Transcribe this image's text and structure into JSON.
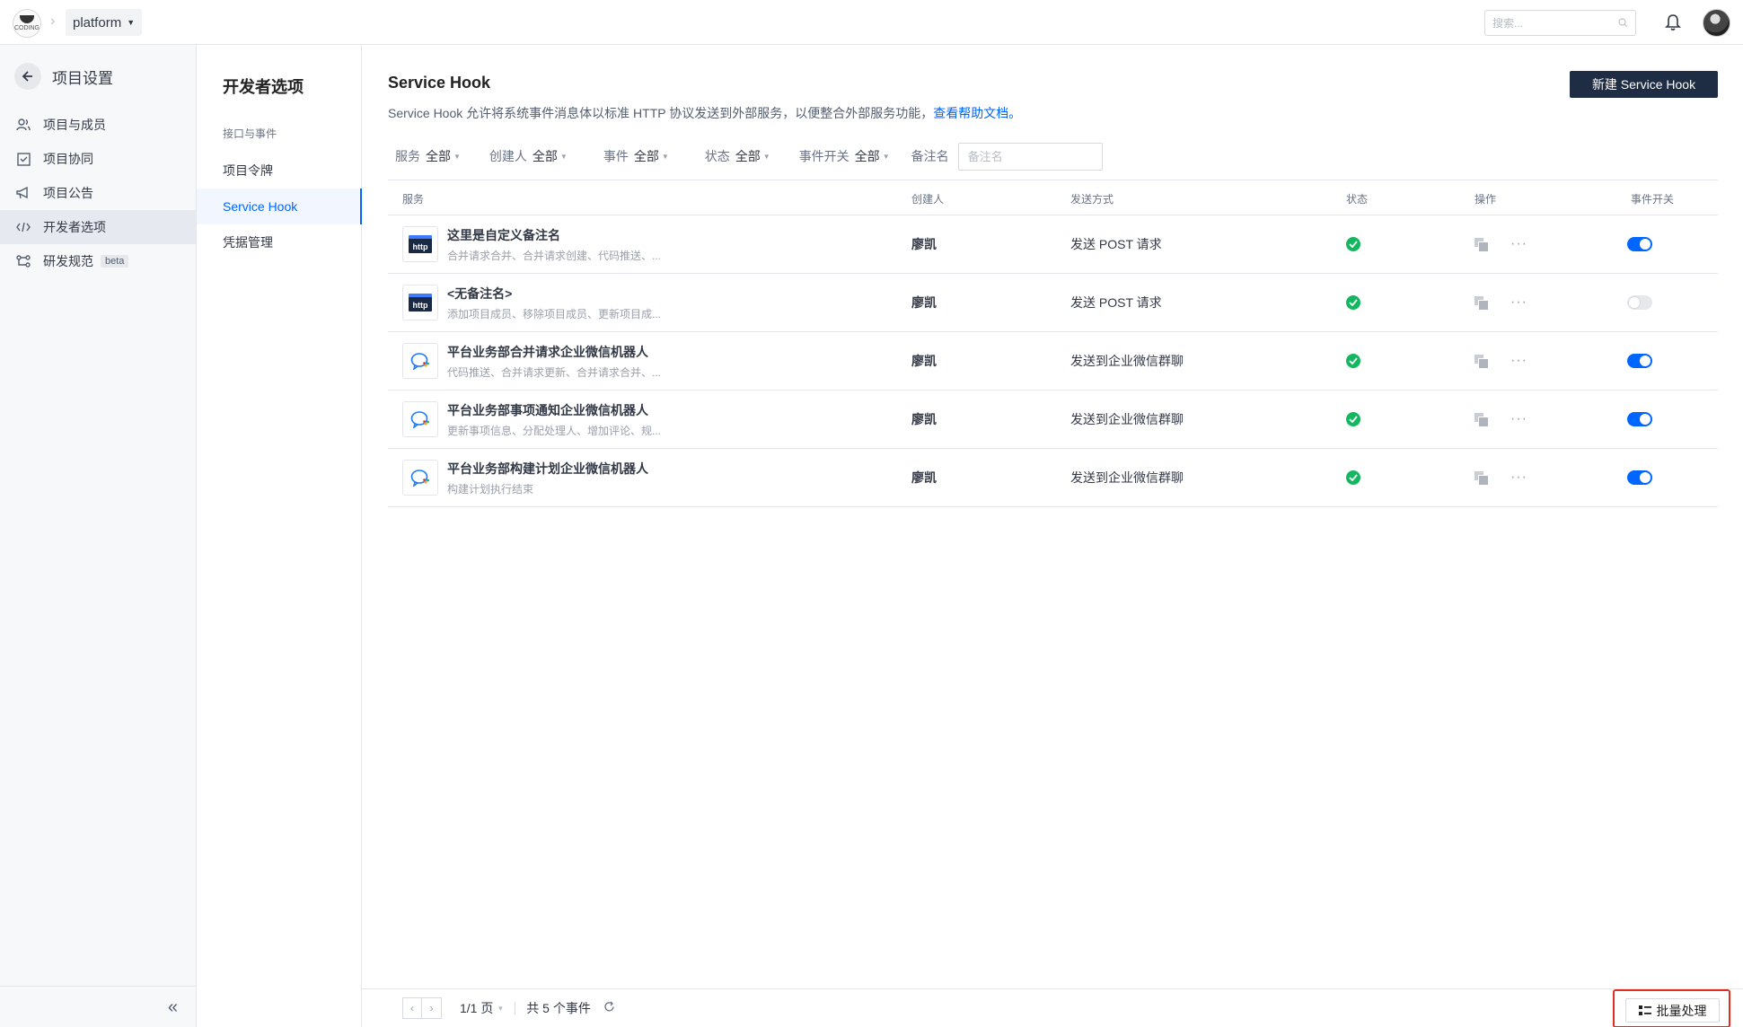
{
  "topbar": {
    "logo_text": "CODING",
    "project_name": "platform",
    "search_placeholder": "搜索..."
  },
  "sidebar": {
    "title": "项目设置",
    "items": [
      {
        "label": "项目与成员",
        "icon": "members-icon"
      },
      {
        "label": "项目协同",
        "icon": "collaboration-icon"
      },
      {
        "label": "项目公告",
        "icon": "announcement-icon"
      },
      {
        "label": "开发者选项",
        "icon": "code-icon",
        "active": true
      },
      {
        "label": "研发规范",
        "icon": "workflow-icon",
        "badge": "beta"
      }
    ]
  },
  "subnav": {
    "title": "开发者选项",
    "group": "接口与事件",
    "items": [
      {
        "label": "项目令牌"
      },
      {
        "label": "Service Hook",
        "active": true
      },
      {
        "label": "凭据管理"
      }
    ]
  },
  "main": {
    "title": "Service Hook",
    "description": "Service Hook 允许将系统事件消息体以标准 HTTP 协议发送到外部服务，以便整合外部服务功能，",
    "help_link": "查看帮助文档。",
    "new_button": "新建 Service Hook",
    "filters": [
      {
        "label": "服务",
        "value": "全部"
      },
      {
        "label": "创建人",
        "value": "全部"
      },
      {
        "label": "事件",
        "value": "全部"
      },
      {
        "label": "状态",
        "value": "全部"
      },
      {
        "label": "事件开关",
        "value": "全部"
      }
    ],
    "remark_label": "备注名",
    "remark_placeholder": "备注名"
  },
  "table": {
    "headers": {
      "service": "服务",
      "creator": "创建人",
      "send": "发送方式",
      "status": "状态",
      "ops": "操作",
      "toggle": "事件开关"
    },
    "rows": [
      {
        "icon": "http",
        "name": "这里是自定义备注名",
        "events": "合并请求合并、合并请求创建、代码推送、...",
        "creator": "廖凯",
        "send": "发送 POST 请求",
        "enabled": true
      },
      {
        "icon": "http",
        "name": "<无备注名>",
        "events": "添加项目成员、移除项目成员、更新项目成...",
        "creator": "廖凯",
        "send": "发送 POST 请求",
        "enabled": false
      },
      {
        "icon": "wecom",
        "name": "平台业务部合并请求企业微信机器人",
        "events": "代码推送、合并请求更新、合并请求合并、...",
        "creator": "廖凯",
        "send": "发送到企业微信群聊",
        "enabled": true
      },
      {
        "icon": "wecom",
        "name": "平台业务部事项通知企业微信机器人",
        "events": "更新事项信息、分配处理人、增加评论、规...",
        "creator": "廖凯",
        "send": "发送到企业微信群聊",
        "enabled": true
      },
      {
        "icon": "wecom",
        "name": "平台业务部构建计划企业微信机器人",
        "events": "构建计划执行结束",
        "creator": "廖凯",
        "send": "发送到企业微信群聊",
        "enabled": true
      }
    ]
  },
  "footer": {
    "page": "1/1 页",
    "total": "共 5 个事件",
    "batch_button": "批量处理"
  },
  "colors": {
    "accent": "#0066ff",
    "primary_button": "#1e2c44",
    "status_ok": "#13b760",
    "highlight_border": "#e02e24"
  }
}
